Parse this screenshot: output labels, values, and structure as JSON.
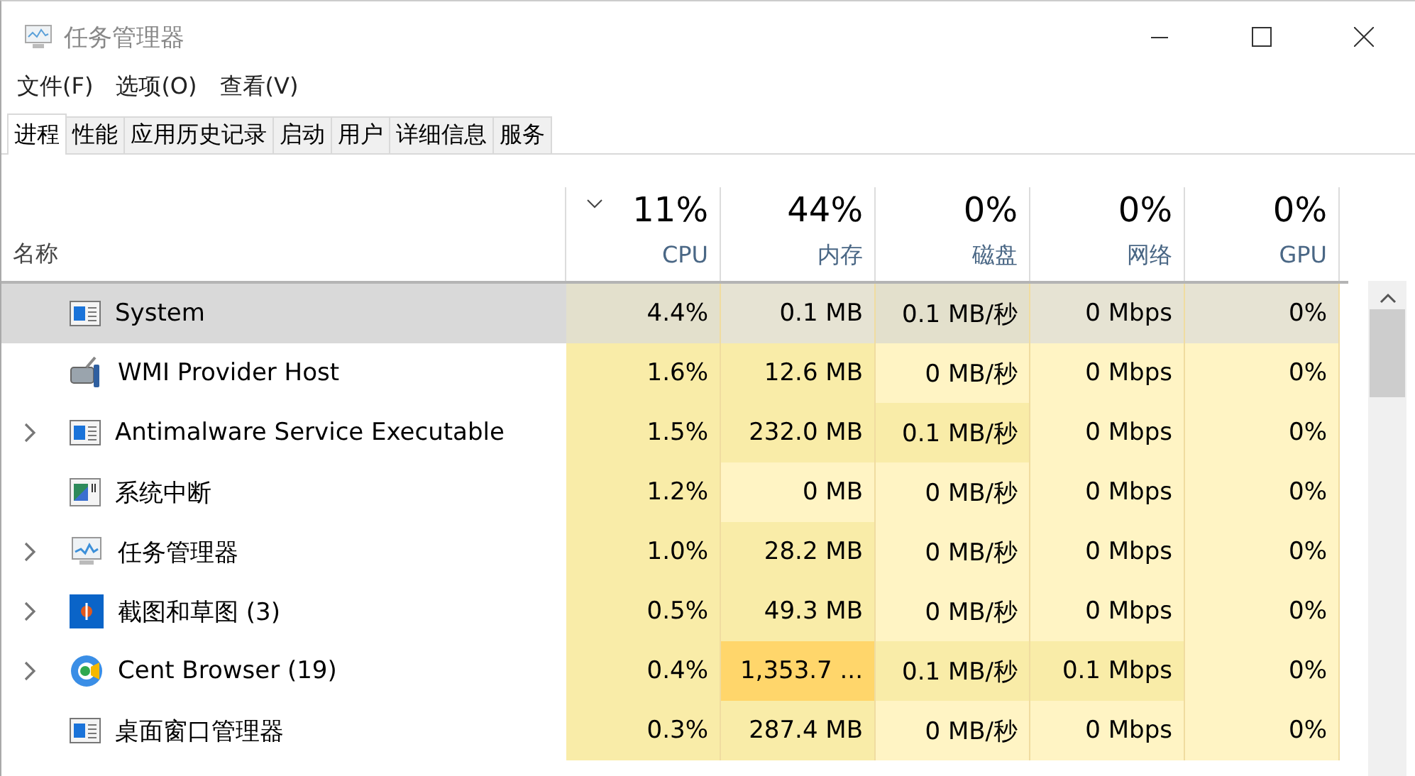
{
  "window": {
    "title": "任务管理器"
  },
  "menu": [
    "文件(F)",
    "选项(O)",
    "查看(V)"
  ],
  "tabs": [
    {
      "label": "进程",
      "selected": true
    },
    {
      "label": "性能",
      "selected": false
    },
    {
      "label": "应用历史记录",
      "selected": false
    },
    {
      "label": "启动",
      "selected": false
    },
    {
      "label": "用户",
      "selected": false
    },
    {
      "label": "详细信息",
      "selected": false
    },
    {
      "label": "服务",
      "selected": false
    }
  ],
  "table": {
    "name_column": "名称",
    "columns": [
      {
        "total": "11%",
        "label": "CPU",
        "sorted": true
      },
      {
        "total": "44%",
        "label": "内存",
        "sorted": false
      },
      {
        "total": "0%",
        "label": "磁盘",
        "sorted": false
      },
      {
        "total": "0%",
        "label": "网络",
        "sorted": false
      },
      {
        "total": "0%",
        "label": "GPU",
        "sorted": false
      }
    ],
    "rows": [
      {
        "name": "System",
        "kind": "system",
        "expandable": false,
        "selected": true,
        "cells": [
          {
            "text": "4.4%",
            "color": "#e3e0cc"
          },
          {
            "text": "0.1 MB",
            "color": "#e6e3d3"
          },
          {
            "text": "0.1 MB/秒",
            "color": "#e3e0cc"
          },
          {
            "text": "0 Mbps",
            "color": "#e6e3d3"
          },
          {
            "text": "0%",
            "color": "#e6e3d3"
          }
        ]
      },
      {
        "name": "WMI Provider Host",
        "kind": "service",
        "expandable": false,
        "selected": false,
        "cells": [
          {
            "text": "1.6%",
            "color": "#f9eca8"
          },
          {
            "text": "12.6 MB",
            "color": "#f9eca8"
          },
          {
            "text": "0 MB/秒",
            "color": "#fff4c4"
          },
          {
            "text": "0 Mbps",
            "color": "#fff4c4"
          },
          {
            "text": "0%",
            "color": "#fff4c4"
          }
        ]
      },
      {
        "name": "Antimalware Service Executable",
        "kind": "system",
        "expandable": true,
        "selected": false,
        "cells": [
          {
            "text": "1.5%",
            "color": "#f9eca8"
          },
          {
            "text": "232.0 MB",
            "color": "#f9eca8"
          },
          {
            "text": "0.1 MB/秒",
            "color": "#f9eca8"
          },
          {
            "text": "0 Mbps",
            "color": "#fff4c4"
          },
          {
            "text": "0%",
            "color": "#fff4c4"
          }
        ]
      },
      {
        "name": "系统中断",
        "kind": "interrupts",
        "expandable": false,
        "selected": false,
        "cells": [
          {
            "text": "1.2%",
            "color": "#f9eca8"
          },
          {
            "text": "0 MB",
            "color": "#fff4c4"
          },
          {
            "text": "0 MB/秒",
            "color": "#fff4c4"
          },
          {
            "text": "0 Mbps",
            "color": "#fff4c4"
          },
          {
            "text": "0%",
            "color": "#fff4c4"
          }
        ]
      },
      {
        "name": "任务管理器",
        "kind": "monitor",
        "expandable": true,
        "selected": false,
        "cells": [
          {
            "text": "1.0%",
            "color": "#f9eca8"
          },
          {
            "text": "28.2 MB",
            "color": "#f9eca8"
          },
          {
            "text": "0 MB/秒",
            "color": "#fff4c4"
          },
          {
            "text": "0 Mbps",
            "color": "#fff4c4"
          },
          {
            "text": "0%",
            "color": "#fff4c4"
          }
        ]
      },
      {
        "name": "截图和草图 (3)",
        "kind": "snip",
        "expandable": true,
        "selected": false,
        "cells": [
          {
            "text": "0.5%",
            "color": "#f9eca8"
          },
          {
            "text": "49.3 MB",
            "color": "#f9eca8"
          },
          {
            "text": "0 MB/秒",
            "color": "#fff4c4"
          },
          {
            "text": "0 Mbps",
            "color": "#fff4c4"
          },
          {
            "text": "0%",
            "color": "#fff4c4"
          }
        ]
      },
      {
        "name": "Cent Browser (19)",
        "kind": "browser",
        "expandable": true,
        "selected": false,
        "cells": [
          {
            "text": "0.4%",
            "color": "#f9eca8"
          },
          {
            "text": "1,353.7 ...",
            "color": "#ffd66b"
          },
          {
            "text": "0.1 MB/秒",
            "color": "#f9eca8"
          },
          {
            "text": "0.1 Mbps",
            "color": "#f9eca8"
          },
          {
            "text": "0%",
            "color": "#fff4c4"
          }
        ]
      },
      {
        "name": "桌面窗口管理器",
        "kind": "system",
        "expandable": false,
        "selected": false,
        "cells": [
          {
            "text": "0.3%",
            "color": "#f9eca8"
          },
          {
            "text": "287.4 MB",
            "color": "#f9eca8"
          },
          {
            "text": "0 MB/秒",
            "color": "#fff4c4"
          },
          {
            "text": "0 Mbps",
            "color": "#fff4c4"
          },
          {
            "text": "0%",
            "color": "#fff4c4"
          }
        ]
      }
    ]
  }
}
